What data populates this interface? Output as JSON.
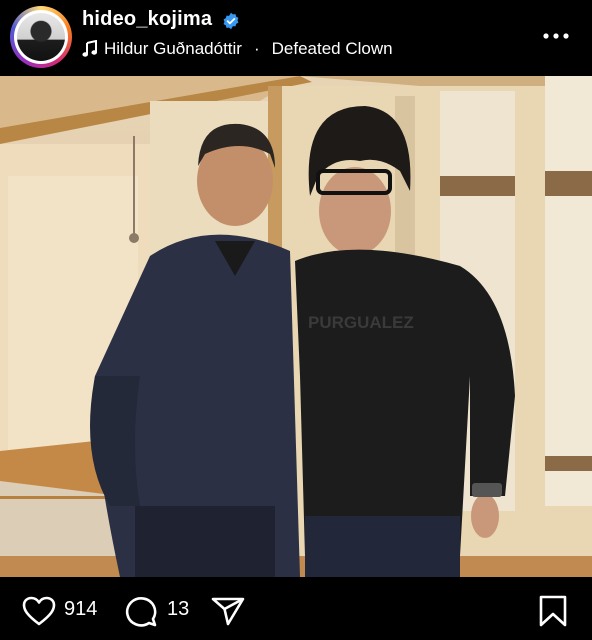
{
  "post": {
    "username": "hideo_kojima",
    "music": {
      "artist": "Hildur Guðnadóttir",
      "separator": "·",
      "track": "Defeated Clown"
    },
    "likes": "914",
    "comments": "13"
  },
  "colors": {
    "verified": "#3897F0",
    "background": "#000000"
  },
  "icons": [
    "verified-badge-icon",
    "music-note-icon",
    "more-options-icon",
    "mute-icon",
    "heart-icon",
    "comment-icon",
    "share-icon",
    "bookmark-icon"
  ]
}
